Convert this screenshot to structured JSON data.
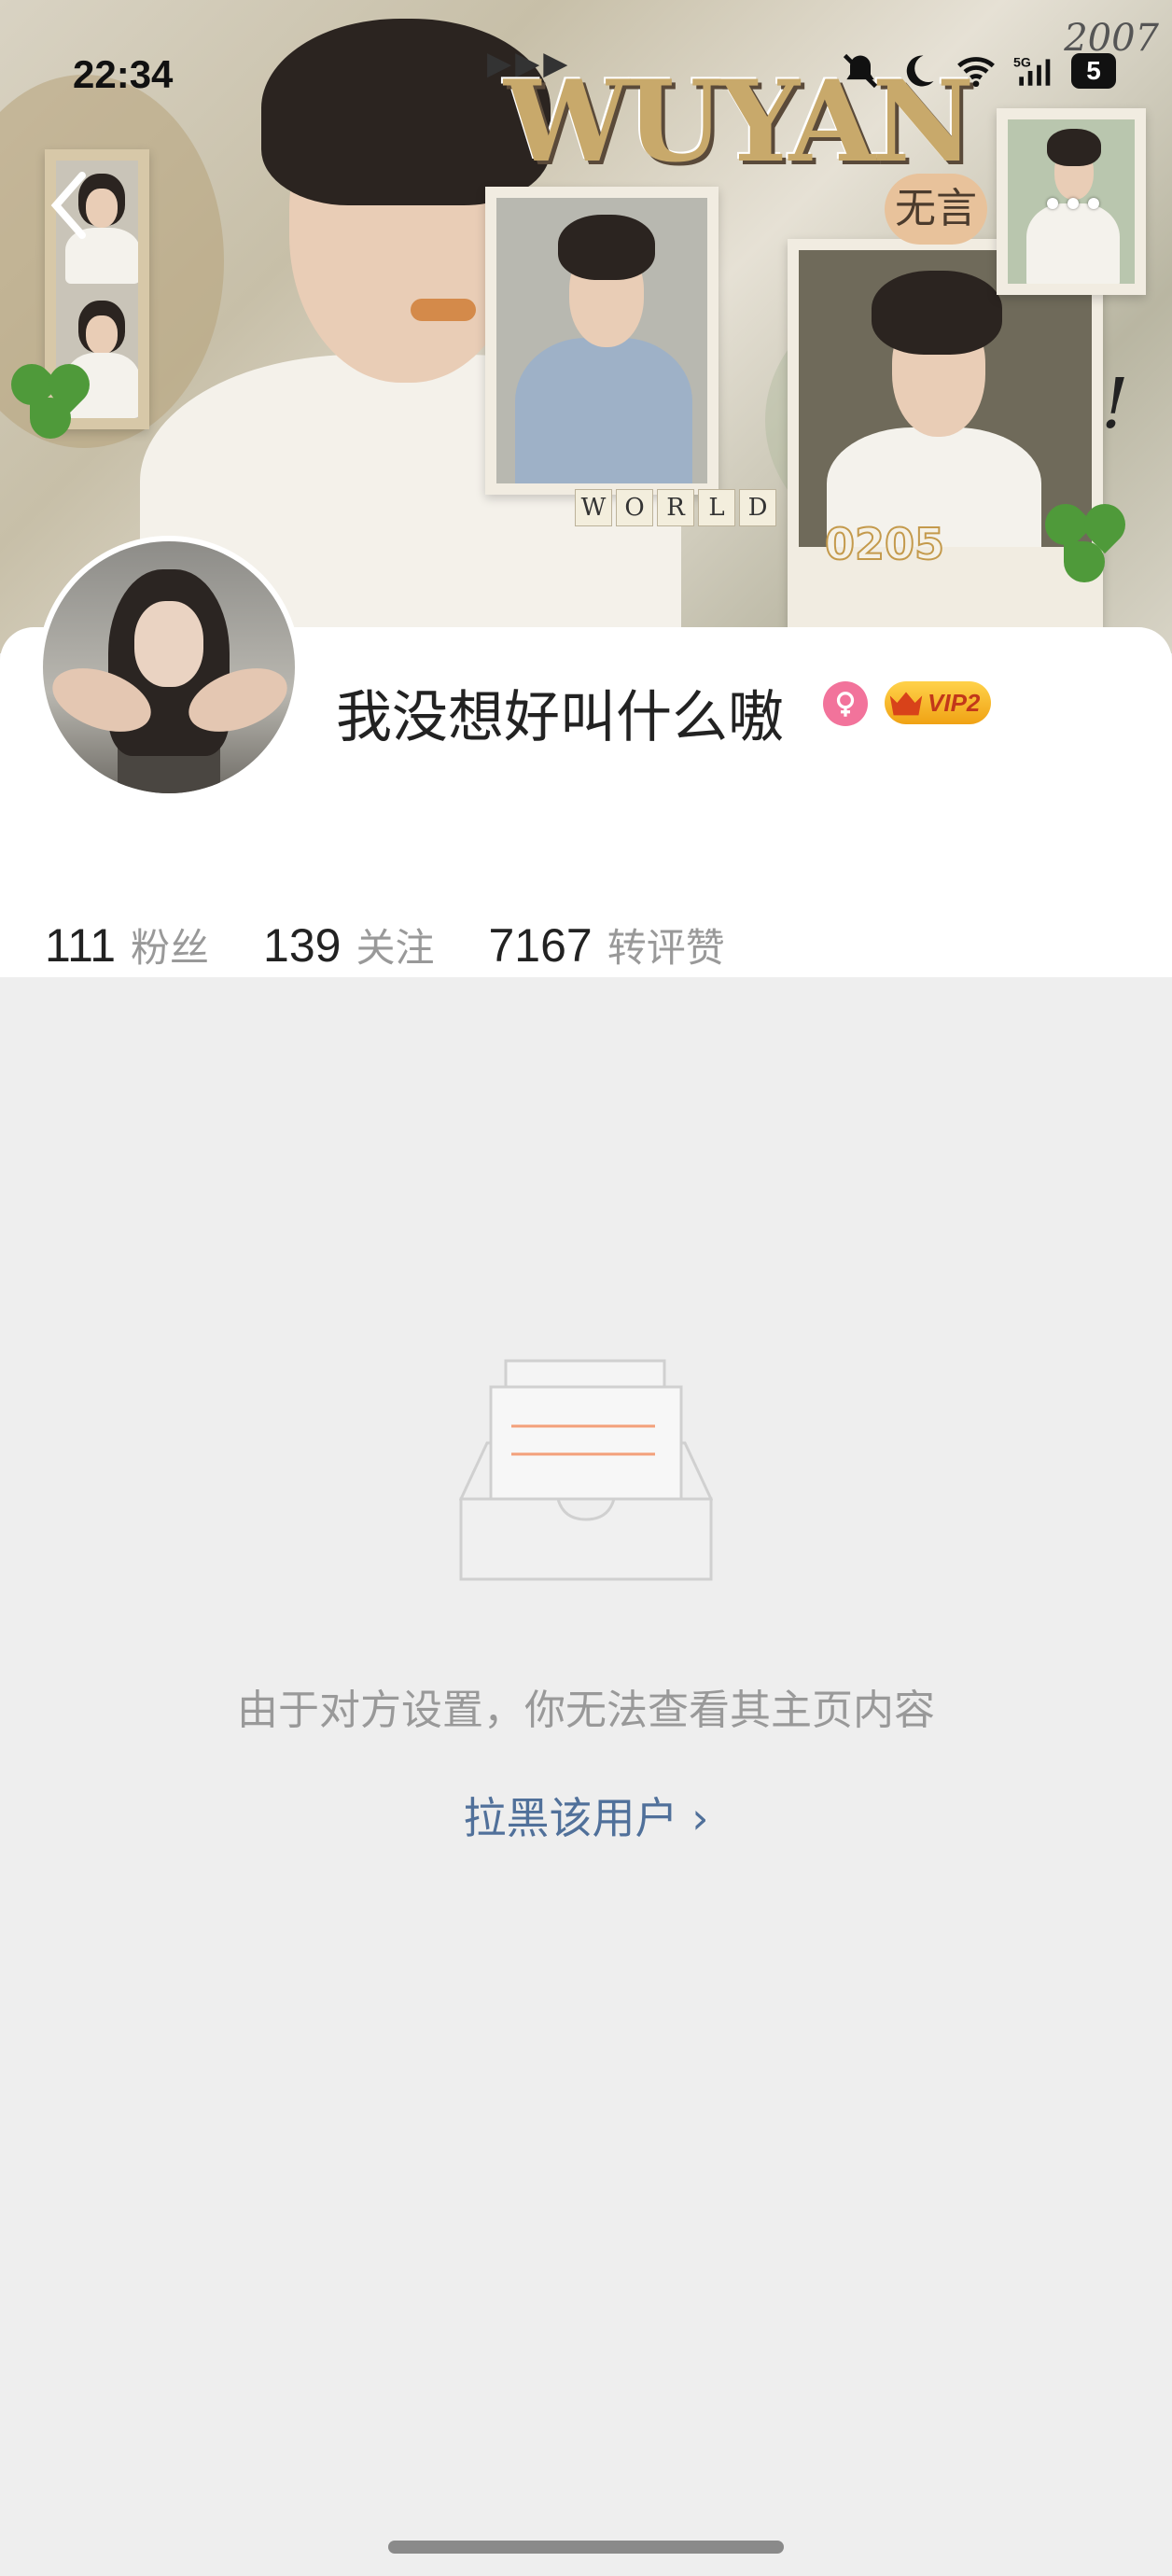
{
  "status_bar": {
    "time": "22:34",
    "network": "5G",
    "battery": "5"
  },
  "banner": {
    "title_art": "WUYAN",
    "subtitle_art": "无言",
    "year": "2007",
    "number": "0205",
    "tiles": [
      "W",
      "O",
      "R",
      "L",
      "D"
    ]
  },
  "nav": {
    "back_icon": "chevron-left-icon",
    "more_icon": "more-dots-icon"
  },
  "profile": {
    "username": "我没想好叫什么嗷",
    "gender": "female",
    "vip_label": "VIP2",
    "stats": [
      {
        "value": "111",
        "label": "粉丝"
      },
      {
        "value": "139",
        "label": "关注"
      },
      {
        "value": "7167",
        "label": "转评赞"
      }
    ]
  },
  "empty_state": {
    "message": "由于对方设置，你无法查看其主页内容",
    "block_link": "拉黑该用户 ›"
  },
  "colors": {
    "background": "#eeeeee",
    "link": "#50709a",
    "gender": "#f2739b",
    "vip": "#f0a214"
  }
}
